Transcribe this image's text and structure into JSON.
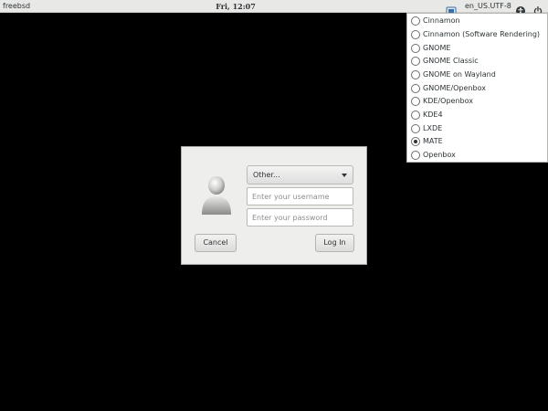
{
  "topbar": {
    "hostname": "freebsd",
    "clock": "Fri, 12:07",
    "locale": "en_US.UTF-8",
    "session_icon": "session-selector-icon",
    "accessibility_icon": "accessibility-icon",
    "power_icon": "power-icon"
  },
  "sessions": {
    "items": [
      {
        "label": "Cinnamon",
        "selected": false
      },
      {
        "label": "Cinnamon (Software Rendering)",
        "selected": false
      },
      {
        "label": "GNOME",
        "selected": false
      },
      {
        "label": "GNOME Classic",
        "selected": false
      },
      {
        "label": "GNOME on Wayland",
        "selected": false
      },
      {
        "label": "GNOME/Openbox",
        "selected": false
      },
      {
        "label": "KDE/Openbox",
        "selected": false
      },
      {
        "label": "KDE4",
        "selected": false
      },
      {
        "label": "LXDE",
        "selected": false
      },
      {
        "label": "MATE",
        "selected": true
      },
      {
        "label": "Openbox",
        "selected": false
      }
    ]
  },
  "login": {
    "user_select": "Other...",
    "username_placeholder": "Enter your username",
    "password_placeholder": "Enter your password",
    "cancel_label": "Cancel",
    "login_label": "Log In"
  },
  "colors": {
    "background": "#000000",
    "panel": "#e8e8e7",
    "dialog": "#eeeeec",
    "text": "#2e3436"
  }
}
